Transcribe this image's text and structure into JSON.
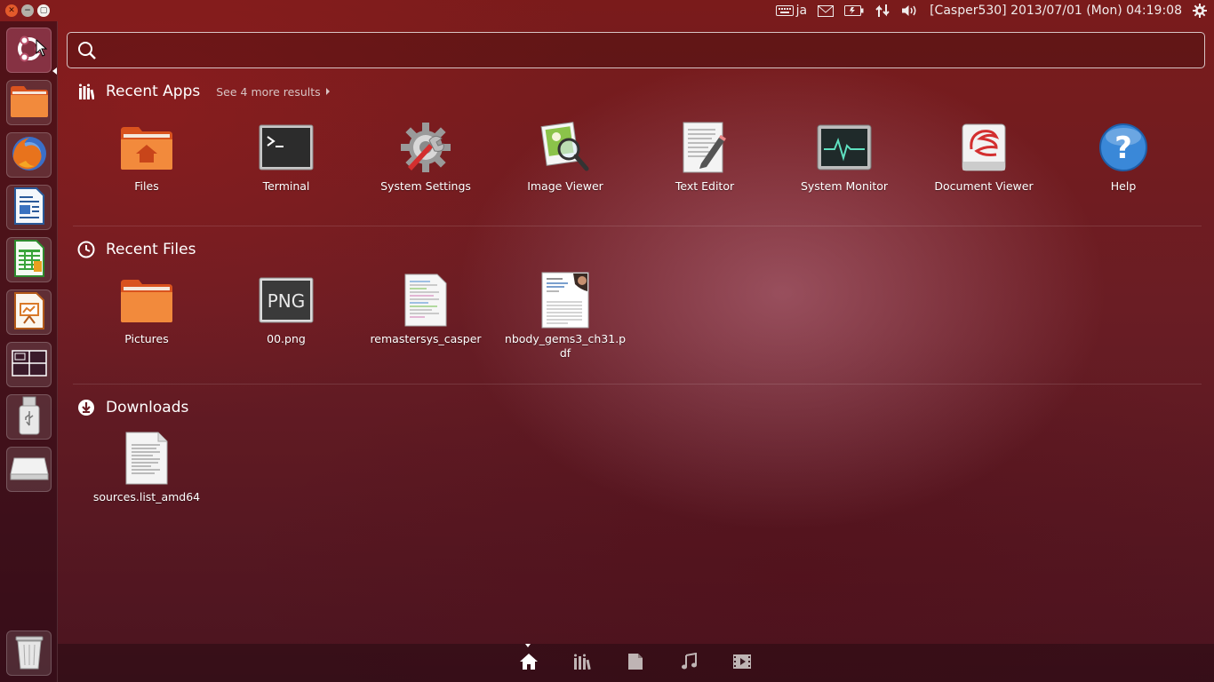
{
  "top_panel": {
    "keyboard_layout": "ja",
    "user_datetime": "[Casper530] 2013/07/01 (Mon) 04:19:08",
    "indicators": [
      "keyboard-icon",
      "mail-icon",
      "battery-icon",
      "network-icon",
      "volume-icon",
      "gear-icon"
    ]
  },
  "search": {
    "value": "",
    "placeholder": ""
  },
  "recent_apps": {
    "title": "Recent Apps",
    "see_more": "See 4 more results",
    "items": [
      {
        "label": "Files",
        "icon": "folder-icon"
      },
      {
        "label": "Terminal",
        "icon": "terminal-icon"
      },
      {
        "label": "System Settings",
        "icon": "settings-icon"
      },
      {
        "label": "Image Viewer",
        "icon": "image-viewer-icon"
      },
      {
        "label": "Text Editor",
        "icon": "text-editor-icon"
      },
      {
        "label": "System Monitor",
        "icon": "system-monitor-icon"
      },
      {
        "label": "Document Viewer",
        "icon": "document-viewer-icon"
      },
      {
        "label": "Help",
        "icon": "help-icon"
      }
    ]
  },
  "recent_files": {
    "title": "Recent Files",
    "items": [
      {
        "label": "Pictures",
        "icon": "folder-icon"
      },
      {
        "label": "00.png",
        "icon": "png-file-icon",
        "badge": "PNG"
      },
      {
        "label": "remastersys_casper",
        "icon": "document-thumbnail-icon"
      },
      {
        "label": "nbody_gems3_ch31.pdf",
        "icon": "pdf-thumbnail-icon"
      }
    ]
  },
  "downloads": {
    "title": "Downloads",
    "items": [
      {
        "label": "sources.list_amd64",
        "icon": "text-file-icon"
      }
    ]
  },
  "launcher": [
    "ubuntu-dash-icon",
    "files-icon",
    "firefox-icon",
    "writer-icon",
    "calc-icon",
    "impress-icon",
    "workspace-switcher-icon",
    "usb-drive-icon",
    "removable-disk-icon",
    "trash-icon"
  ],
  "lenses": [
    "home-lens-icon",
    "applications-lens-icon",
    "files-lens-icon",
    "music-lens-icon",
    "video-lens-icon"
  ]
}
